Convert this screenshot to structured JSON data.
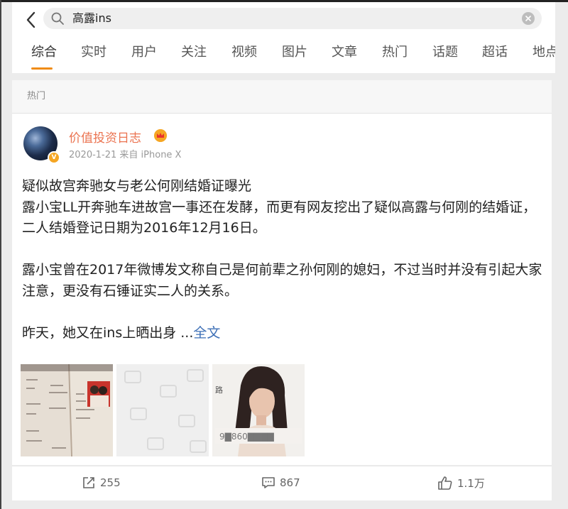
{
  "search": {
    "query": "高露ins"
  },
  "tabs": [
    "综合",
    "实时",
    "用户",
    "关注",
    "视频",
    "图片",
    "文章",
    "热门",
    "话题",
    "超话",
    "地点"
  ],
  "section": {
    "label": "热门"
  },
  "post": {
    "author": "价值投资日志",
    "meta": "2020-1-21 来自 iPhone X",
    "verified_badge": "V",
    "paragraphs": {
      "p1": "疑似故宫奔驰女与老公何刚结婚证曝光",
      "p2": "露小宝LL开奔驰车进故宫一事还在发酵，而更有网友挖出了疑似高露与何刚的结婚证，二人结婚登记日期为2016年12月16日。",
      "p3": "露小宝曾在2017年微博发文称自己是何前辈之孙何刚的媳妇，不过当时并没有引起大家注意，更没有石锤证实二人的关系。",
      "p4": "昨天，她又在ins上晒出身 ..."
    },
    "more_label": "全文",
    "images": [
      "marriage-certificate-photo",
      "image-placeholder",
      "woman-portrait-photo"
    ]
  },
  "actions": {
    "repost": "255",
    "comment": "867",
    "like": "1.1万"
  },
  "colors": {
    "accent": "#f08c17",
    "username": "#eb7350",
    "link": "#3d6fb6"
  }
}
